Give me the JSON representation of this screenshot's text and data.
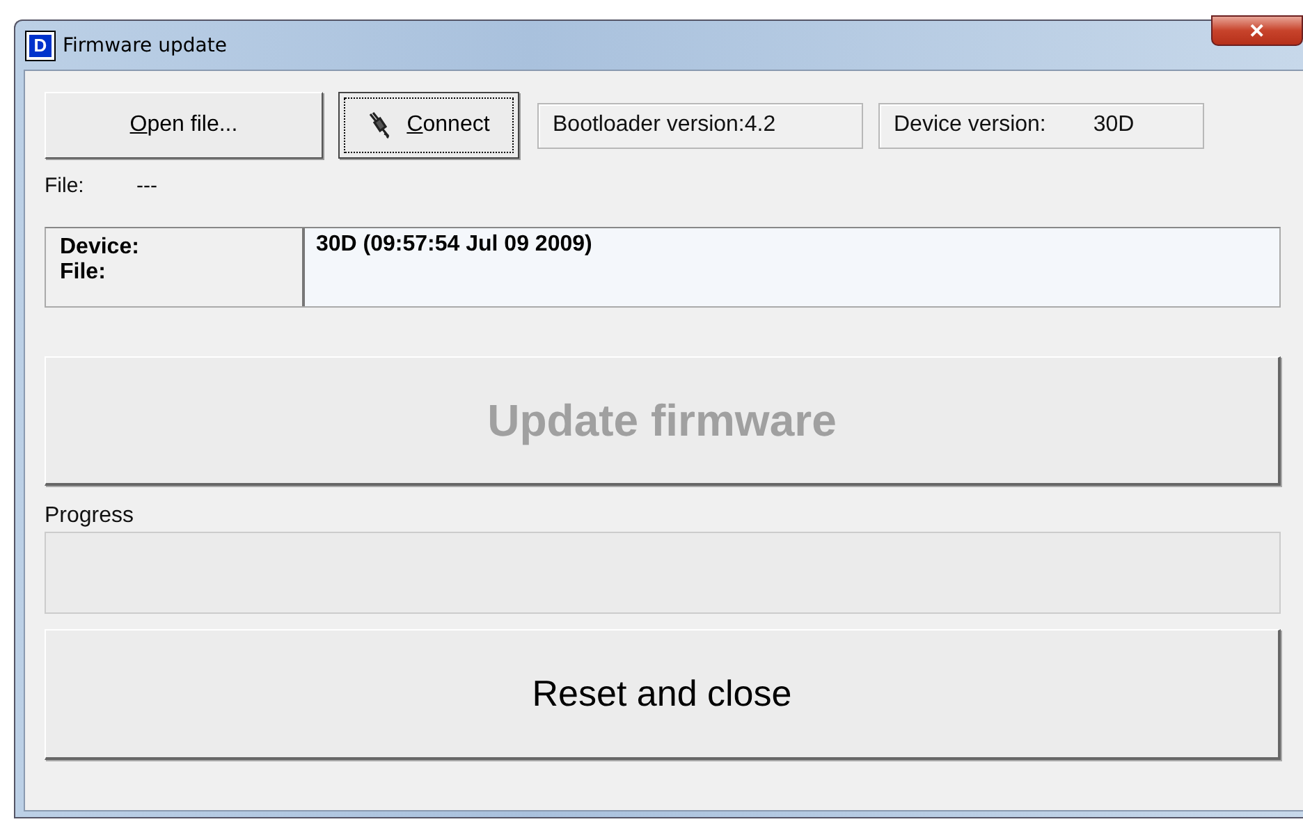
{
  "window": {
    "title": "Firmware update",
    "icon_letter": "D",
    "close_label": "✕"
  },
  "toolbar": {
    "buttons": [
      {
        "label": "Open file...",
        "underline_first": true,
        "focused": false,
        "kind": "plain"
      },
      {
        "label": "Connect",
        "underline_first": true,
        "focused": true,
        "kind": "plug"
      }
    ],
    "fields": [
      {
        "label": "Bootloader version:",
        "value": "4.2"
      },
      {
        "label": "Device version:",
        "value": "30D"
      }
    ]
  },
  "file_line": {
    "label": "File:",
    "value": "---"
  },
  "info": {
    "labels": [
      "Device:",
      "File:"
    ],
    "value": "30D (09:57:54 Jul 09 2009)"
  },
  "update_button": {
    "label": "Update firmware",
    "disabled": true
  },
  "progress": {
    "label": "Progress",
    "level": 0
  },
  "reset_button": {
    "label": "Reset and close",
    "disabled": false
  }
}
